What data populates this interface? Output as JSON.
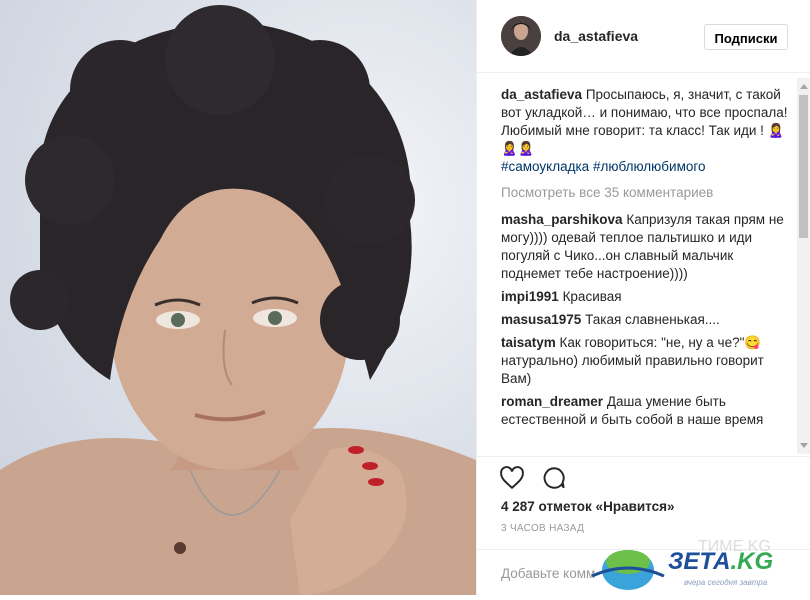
{
  "post": {
    "username": "da_astafieva",
    "follow_label": "Подписки"
  },
  "caption": {
    "username": "da_astafieva",
    "text": "Просыпаюсь, я, значит, с такой вот укладкой… и понимаю, что все проспала! Любимый мне говорит: та класс! Так иди ! 🙎‍♀️🙎‍♀️🙎‍♀️",
    "hashtags": [
      "#самоукладка",
      "#люблюлюбимого"
    ]
  },
  "view_all_label": "Посмотреть все 35 комментариев",
  "comments": [
    {
      "user": "masha_parshikova",
      "text": "Капризуля такая прям не могу)))) одевай теплое пальтишко и иди погуляй с Чико...он славный мальчик поднемет тебе настроение))))"
    },
    {
      "user": "impi1991",
      "text": "Красивая"
    },
    {
      "user": "masusa1975",
      "text": "Такая славненькая...."
    },
    {
      "user": "taisatym",
      "text": "Как говориться: \"не, ну а че?\"😋 натурально) любимый правильно говорит Вам)"
    },
    {
      "user": "roman_dreamer",
      "text": "Даша умение быть естественной и быть собой в наше время"
    }
  ],
  "likes_label": "4 287 отметок «Нравится»",
  "time_label": "3 ЧАСОВ НАЗАД",
  "add_comment_placeholder": "Добавьте комм",
  "watermark": {
    "brand": "ЗЕТА",
    "tld": ".KG",
    "slogan": "вчера сегодня завтра",
    "faint": "ТИМЕ.KG"
  },
  "colors": {
    "hashtag": "#003569",
    "secondary_text": "#999999",
    "border": "#efefef"
  }
}
